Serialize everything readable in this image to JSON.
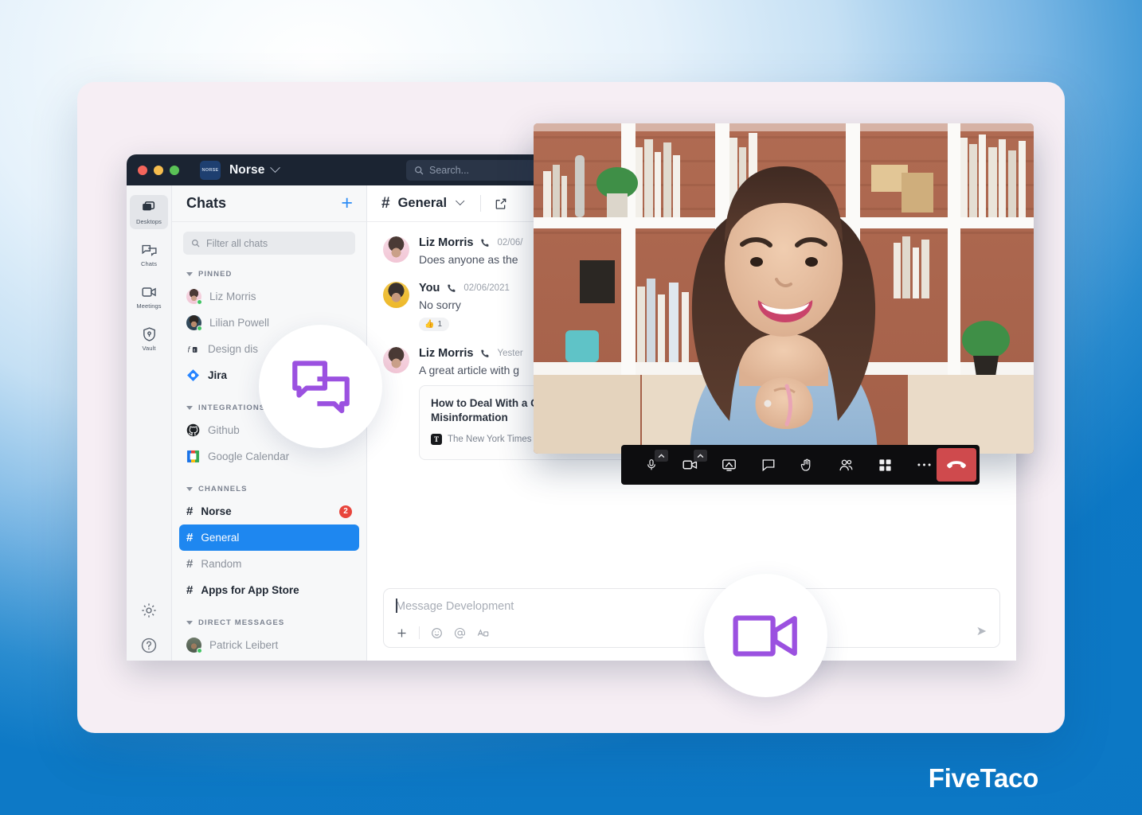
{
  "brand": {
    "name": "FiveTaco"
  },
  "window": {
    "workspace": "Norse",
    "workspace_logo_text": "NORSE",
    "traffic_lights": [
      "close",
      "minimize",
      "zoom"
    ],
    "search": {
      "placeholder": "Search...",
      "icon": "search-icon"
    }
  },
  "rail": {
    "items": [
      {
        "label": "Desktops",
        "icon": "desktops-icon",
        "active": true
      },
      {
        "label": "Chats",
        "icon": "chats-icon",
        "active": false
      },
      {
        "label": "Meetings",
        "icon": "meetings-icon",
        "active": false
      },
      {
        "label": "Vault",
        "icon": "vault-shield-icon",
        "active": false
      }
    ],
    "bottom": [
      {
        "label": "Settings",
        "icon": "gear-icon"
      },
      {
        "label": "Help",
        "icon": "help-question-icon"
      }
    ]
  },
  "chat_list": {
    "title": "Chats",
    "add_label": "+",
    "filter_placeholder": "Filter all chats",
    "groups": [
      {
        "label": "PINNED",
        "items": [
          {
            "name": "Liz Morris",
            "type": "avatar",
            "avatar": "liz",
            "presence": "online",
            "bold": false
          },
          {
            "name": "Lilian Powell",
            "type": "avatar",
            "avatar": "lilian",
            "presence": "online",
            "bold": false
          },
          {
            "name": "Design dis",
            "type": "icon",
            "icon": "design-group-icon",
            "bold": false
          },
          {
            "name": "Jira",
            "type": "icon",
            "icon": "jira-icon",
            "bold": true
          }
        ]
      },
      {
        "label": "INTEGRATIONS",
        "items": [
          {
            "name": "Github",
            "type": "icon",
            "icon": "github-icon",
            "bold": false
          },
          {
            "name": "Google Calendar",
            "type": "icon",
            "icon": "google-calendar-icon",
            "bold": false
          }
        ]
      },
      {
        "label": "CHANNELS",
        "items": [
          {
            "name": "Norse",
            "type": "hash",
            "bold": true,
            "badge": "2"
          },
          {
            "name": "General",
            "type": "hash",
            "selected": true
          },
          {
            "name": "Random",
            "type": "hash",
            "bold": false
          },
          {
            "name": "Apps for App Store",
            "type": "hash",
            "bold": true
          }
        ]
      },
      {
        "label": "DIRECT MESSAGES",
        "items": [
          {
            "name": "Patrick Leibert",
            "type": "avatar",
            "avatar": "patrick",
            "presence": "online",
            "bold": false
          }
        ]
      }
    ]
  },
  "conversation": {
    "hash": "#",
    "title": "General",
    "chevron": "chevron-down-icon",
    "popout_icon": "open-external-icon",
    "messages": [
      {
        "author": "Liz Morris",
        "avatar": "liz",
        "call_icon": "phone-icon",
        "time": "02/06/",
        "text": "Does anyone as the"
      },
      {
        "author": "You",
        "avatar": "you",
        "call_icon": "phone-icon",
        "time": "02/06/2021",
        "text": "No sorry",
        "reaction": {
          "emoji": "👍",
          "count": "1"
        }
      },
      {
        "author": "Liz Morris",
        "avatar": "liz",
        "call_icon": "phone-icon",
        "time": "Yester",
        "text": "A great article with g",
        "link_card": {
          "title": "How to Deal With a Crisis of Misinformation",
          "source": "The New York Times",
          "source_mark": "T",
          "thumbnail": "news-illustration-thumbnail"
        }
      }
    ]
  },
  "composer": {
    "placeholder": "Message Development",
    "tools": [
      {
        "icon": "plus-icon",
        "label": "Add attachment"
      },
      {
        "icon": "emoji-icon",
        "label": "Emoji"
      },
      {
        "icon": "mention-at-icon",
        "label": "Mention"
      },
      {
        "icon": "text-format-icon",
        "label": "Formatting"
      }
    ],
    "send_icon": "send-icon"
  },
  "video_call": {
    "participant": "video-participant-feed",
    "toolbar": [
      {
        "icon": "microphone-icon",
        "label": "Mute",
        "has_caret": true
      },
      {
        "icon": "camera-icon",
        "label": "Stop video",
        "has_caret": true
      },
      {
        "icon": "share-screen-icon",
        "label": "Share screen",
        "has_caret": false
      },
      {
        "icon": "chat-bubble-icon",
        "label": "Chat",
        "has_caret": false
      },
      {
        "icon": "raise-hand-icon",
        "label": "Raise hand",
        "has_caret": false
      },
      {
        "icon": "participants-icon",
        "label": "Participants",
        "has_caret": false
      },
      {
        "icon": "grid-view-icon",
        "label": "View",
        "has_caret": false
      },
      {
        "icon": "more-options-icon",
        "label": "More",
        "has_caret": false
      }
    ],
    "hangup": {
      "icon": "hangup-phone-icon",
      "label": "Leave call",
      "color": "#cf4a4d"
    }
  },
  "feature_bubbles": [
    {
      "icon": "chat-bubbles-icon",
      "label": "Chat feature",
      "color": "#9b51e0"
    },
    {
      "icon": "video-camera-icon",
      "label": "Video feature",
      "color": "#9b51e0"
    }
  ],
  "colors": {
    "accent_blue": "#1e87f0",
    "purple": "#9b51e0",
    "card_pink": "#f6eef4",
    "titlebar": "#1b2432",
    "badge_red": "#e8453c",
    "hangup_red": "#cf4a4d"
  }
}
